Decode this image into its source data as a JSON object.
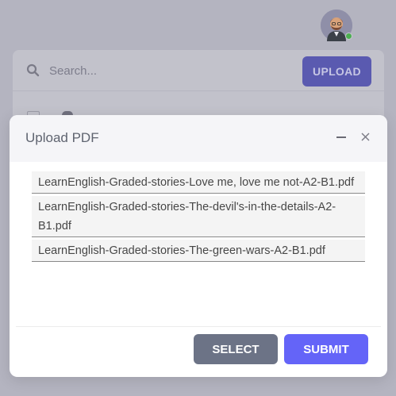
{
  "app": {
    "search": {
      "placeholder": "Search..."
    },
    "upload_button_label": "UPLOAD",
    "user": {
      "status": "online",
      "status_color": "#4caf50"
    }
  },
  "modal": {
    "title": "Upload PDF",
    "files": [
      "LearnEnglish-Graded-stories-Love me, love me not-A2-B1.pdf",
      "LearnEnglish-Graded-stories-The-devil's-in-the-details-A2-B1.pdf",
      "LearnEnglish-Graded-stories-The-green-wars-A2-B1.pdf"
    ],
    "select_label": "SELECT",
    "submit_label": "SUBMIT"
  },
  "colors": {
    "overlay_background": "#b4b4c0",
    "primary": "#6464f8",
    "secondary": "#6c7386"
  },
  "icons": [
    "avatar",
    "search-icon",
    "minimize-icon",
    "close-icon"
  ]
}
